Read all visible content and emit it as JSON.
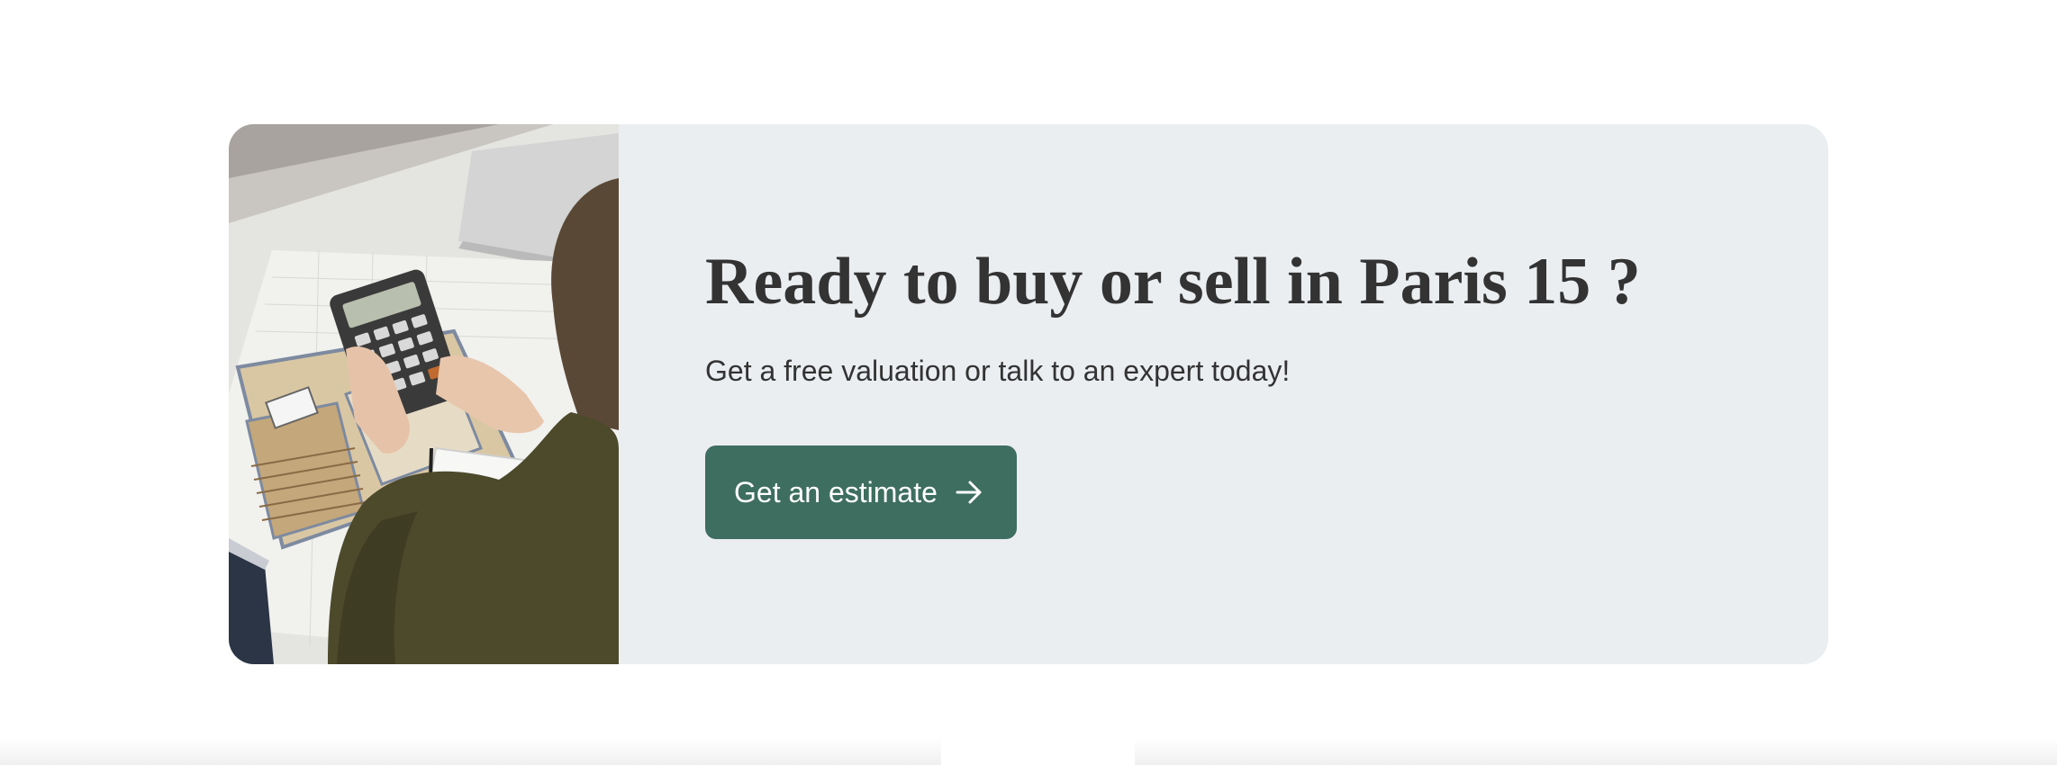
{
  "cta": {
    "headline": "Ready to buy or sell in Paris 15 ?",
    "subtext": "Get a free valuation or talk to an expert today!",
    "button_label": "Get an estimate",
    "button_icon": "arrow-right-icon",
    "image_subject": "person-using-calculator-over-floor-plan",
    "colors": {
      "card_background": "#ebeef1",
      "button_background": "#3e6e5f",
      "text": "#333333"
    }
  }
}
